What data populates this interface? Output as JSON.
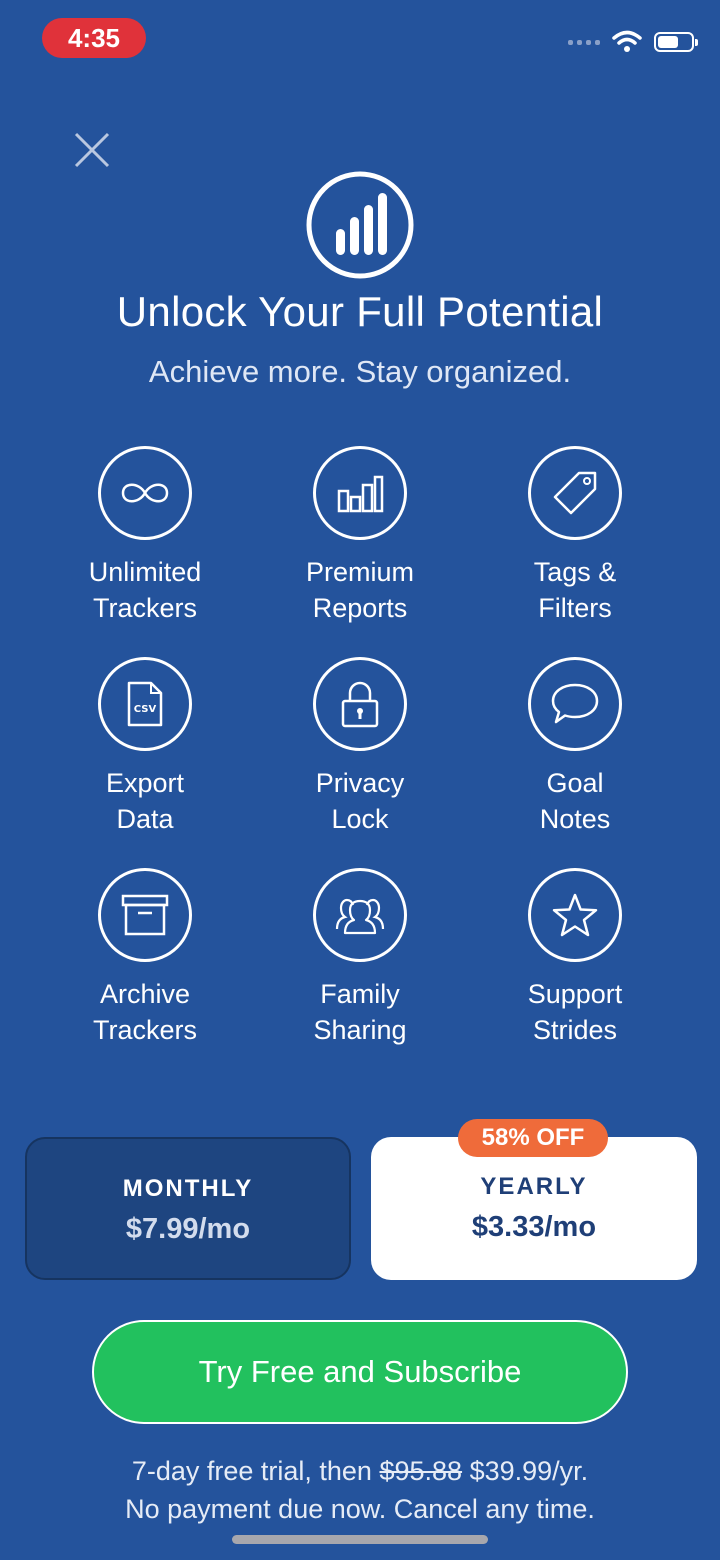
{
  "status_bar": {
    "time": "4:35"
  },
  "header": {
    "title": "Unlock Your Full Potential",
    "subtitle": "Achieve more. Stay organized."
  },
  "features": [
    {
      "label": "Unlimited\nTrackers",
      "icon": "infinity-icon"
    },
    {
      "label": "Premium\nReports",
      "icon": "bar-chart-icon"
    },
    {
      "label": "Tags &\nFilters",
      "icon": "tag-icon"
    },
    {
      "label": "Export\nData",
      "icon": "csv-file-icon"
    },
    {
      "label": "Privacy\nLock",
      "icon": "lock-icon"
    },
    {
      "label": "Goal\nNotes",
      "icon": "speech-bubble-icon"
    },
    {
      "label": "Archive\nTrackers",
      "icon": "archive-box-icon"
    },
    {
      "label": "Family\nSharing",
      "icon": "people-icon"
    },
    {
      "label": "Support\nStrides",
      "icon": "star-icon"
    }
  ],
  "plans": {
    "monthly": {
      "name": "MONTHLY",
      "price": "$7.99/mo"
    },
    "yearly": {
      "name": "YEARLY",
      "price": "$3.33/mo",
      "badge": "58% OFF"
    }
  },
  "cta": {
    "label": "Try Free and Subscribe"
  },
  "fine_print": {
    "line1_prefix": "7-day free trial, then",
    "old_price": "$95.88",
    "new_price": "$39.99/yr.",
    "line2": "No payment due now. Cancel any time."
  },
  "colors": {
    "background": "#24539c",
    "cta_green": "#22c15e",
    "badge_orange": "#ef6b3a",
    "selected_plan_bg": "#ffffff",
    "unselected_plan_bg": "#1e4580"
  }
}
